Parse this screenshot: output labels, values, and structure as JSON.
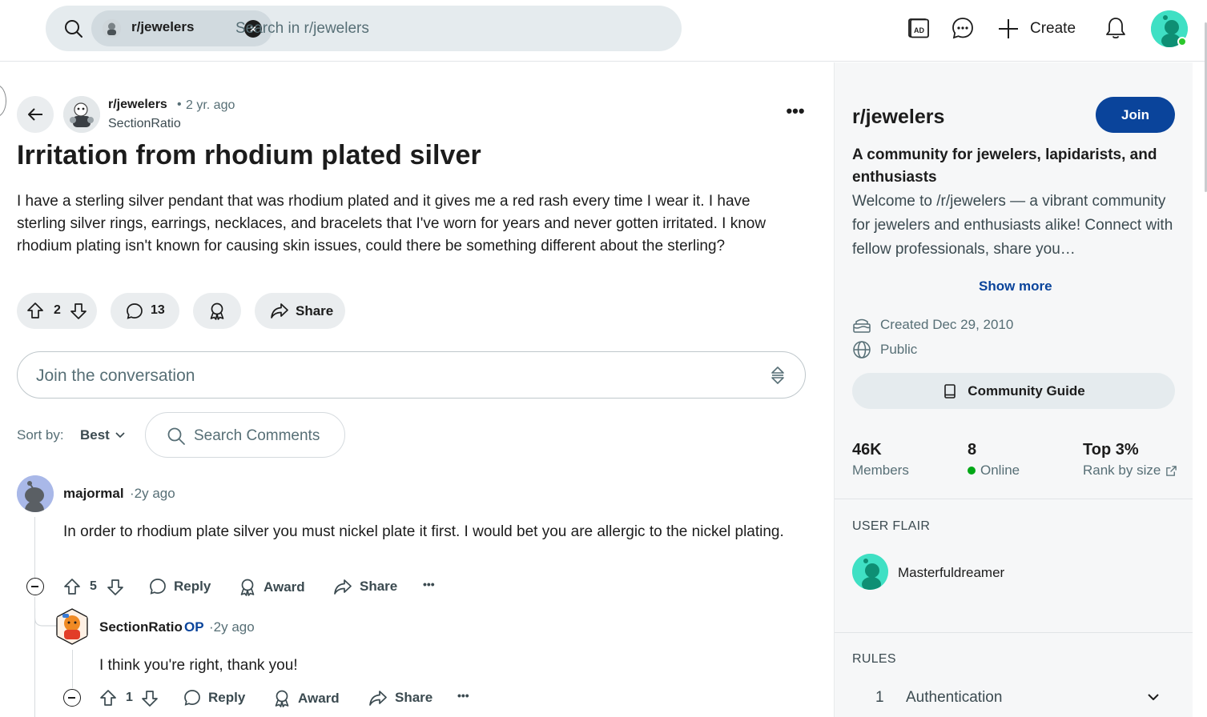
{
  "header": {
    "search_chip_label": "r/jewelers",
    "search_chip_remove": "×",
    "search_placeholder": "Search in r/jewelers",
    "create_label": "Create",
    "icons": [
      "search-icon",
      "advertise-icon",
      "chat-icon",
      "plus-icon",
      "notification-bell-icon"
    ]
  },
  "post": {
    "subreddit": "r/jewelers",
    "separator": "•",
    "time": "2 yr. ago",
    "author": "SectionRatio",
    "more": "•••",
    "title": "Irritation from rhodium plated silver",
    "body": "I have a sterling silver pendant that was rhodium plated and it gives me a red rash every time I wear it. I have sterling silver rings, earrings, necklaces, and bracelets that I've worn for years and never gotten irritated. I know rhodium plating isn't known for causing skin issues, could there be something different about the sterling?",
    "votes": "2",
    "comments_count": "13",
    "share_label": "Share"
  },
  "comment_box": {
    "placeholder": "Join the conversation"
  },
  "sort": {
    "label": "Sort by:",
    "value": "Best",
    "search_placeholder": "Search Comments"
  },
  "comments": [
    {
      "author": "majormal",
      "time": "2y ago",
      "text": "In order to rhodium plate silver you must nickel plate it first. I would bet you are allergic to the nickel plating.",
      "votes": "5",
      "reply_label": "Reply",
      "award_label": "Award",
      "share_label": "Share",
      "more": "•••"
    },
    {
      "author": "SectionRatio",
      "op_badge": "OP",
      "time": "2y ago",
      "text": "I think you're right, thank you!",
      "votes": "1",
      "reply_label": "Reply",
      "award_label": "Award",
      "share_label": "Share",
      "more": "•••"
    }
  ],
  "sidebar": {
    "name": "r/jewelers",
    "join_label": "Join",
    "tagline": "A community for jewelers, lapidarists, and enthusiasts",
    "description": "Welcome to /r/jewelers — a vibrant community for jewelers and enthusiasts alike! Connect with fellow professionals, share you…",
    "show_more": "Show more",
    "created": "Created Dec 29, 2010",
    "visibility": "Public",
    "guide_label": "Community Guide",
    "stats": [
      {
        "value": "46K",
        "label": "Members"
      },
      {
        "value": "8",
        "label": "Online"
      },
      {
        "value": "Top 3%",
        "label": "Rank by size"
      }
    ],
    "user_flair_heading": "USER FLAIR",
    "flair_name": "Masterfuldreamer",
    "rules_heading": "RULES",
    "rules": [
      {
        "number": "1",
        "title": "Authentication"
      }
    ]
  },
  "colors": {
    "accent": "#0a449b",
    "pill_bg": "#eaedef",
    "sidebar_bg": "#f6f7f8",
    "online": "#01a816",
    "avatar_teal": "#3fe0c4"
  }
}
